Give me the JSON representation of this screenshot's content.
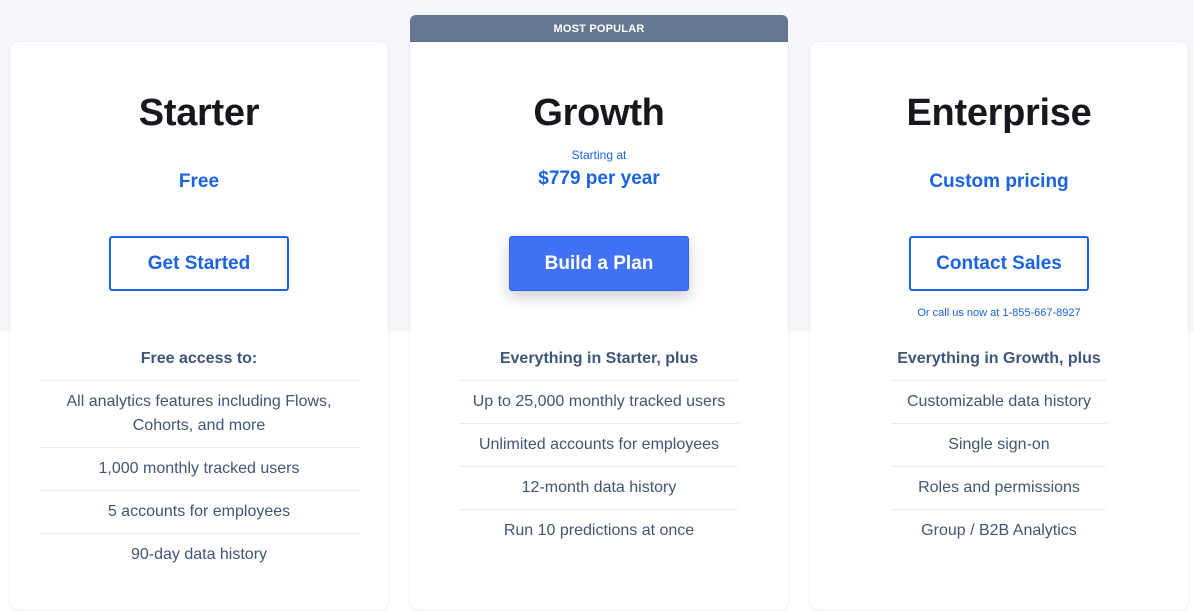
{
  "colors": {
    "accent": "#1a63e6",
    "primary_button": "#4172f6",
    "badge": "#647892",
    "heading": "#16181d",
    "feature_text": "#3e5678",
    "background_band": "#f6f7fb"
  },
  "plans": [
    {
      "name": "Starter",
      "price": "Free",
      "button_label": "Get Started",
      "features_heading": "Free access to:",
      "features": [
        "All analytics features including Flows, Cohorts, and more",
        "1,000 monthly tracked users",
        "5 accounts for employees",
        "90-day data history"
      ]
    },
    {
      "name": "Growth",
      "badge": "MOST POPULAR",
      "price_prefix": "Starting at",
      "price": "$779 per year",
      "button_label": "Build a Plan",
      "features_heading": "Everything in Starter, plus",
      "features": [
        "Up to 25,000 monthly tracked users",
        "Unlimited accounts for employees",
        "12-month data history",
        "Run 10 predictions at once"
      ]
    },
    {
      "name": "Enterprise",
      "price": "Custom pricing",
      "button_label": "Contact Sales",
      "call_note": "Or call us now at 1-855-667-8927",
      "features_heading": "Everything in Growth, plus",
      "features": [
        "Customizable data history",
        "Single sign-on",
        "Roles and permissions",
        "Group / B2B Analytics"
      ]
    }
  ]
}
